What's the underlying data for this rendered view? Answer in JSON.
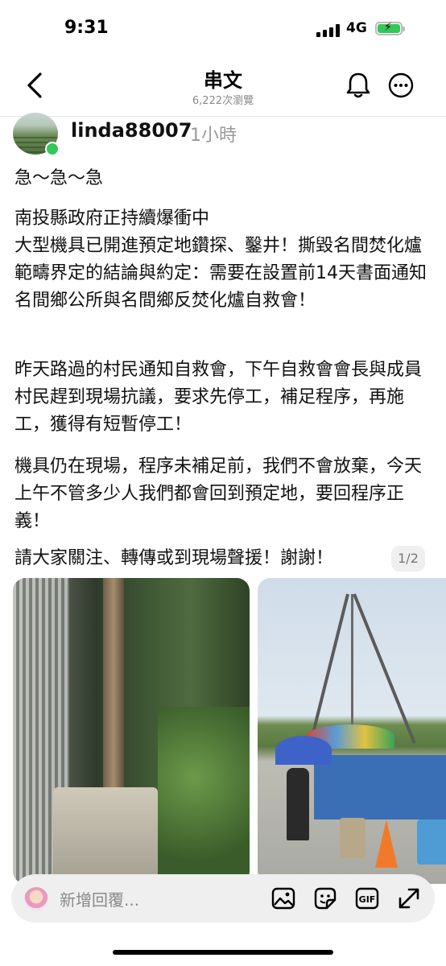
{
  "status_bar": {
    "time": "9:31",
    "network": "4G"
  },
  "header": {
    "title": "串文",
    "views": "6,222次瀏覽"
  },
  "post": {
    "username": "linda88007",
    "time_ago": "1小時",
    "paragraphs": [
      "急～急～急",
      "南投縣政府正持續爆衝中\n大型機具已開進預定地鑽探、鑿井！撕毀名間焚化爐範疇界定的結論與約定：需要在設置前14天書面通知名間鄉公所與名間鄉反焚化爐自救會！",
      "昨天路過的村民通知自救會，下午自救會會長與成員村民趕到現場抗議，要求先停工，補足程序，再施工，獲得有短暫停工！",
      "機具仍在現場，程序未補足前，我們不會放棄，今天上午不管多少人我們都會回到預定地，要回程序正義！",
      "請大家關注、轉傳或到現場聲援！謝謝！"
    ],
    "pager": "1/2",
    "media": [
      "photo-1",
      "photo-2"
    ]
  },
  "reply_bar": {
    "placeholder": "新增回覆..."
  },
  "icons": [
    "back-icon",
    "bell-icon",
    "more-icon",
    "image-icon",
    "sticker-icon",
    "gif-icon",
    "expand-icon",
    "sound-icon"
  ],
  "colors": {
    "online": "#34c759",
    "battery": "#34c759"
  }
}
